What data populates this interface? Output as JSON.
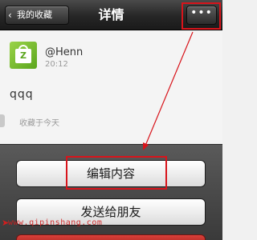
{
  "navbar": {
    "back_label": "我的收藏",
    "title": "详情",
    "more_label": "•••"
  },
  "note": {
    "username": "@Henn",
    "timestamp": "20:12",
    "text": "qqq",
    "saved_label": "收藏于今天"
  },
  "action_sheet": {
    "edit_label": "编辑内容",
    "send_label": "发送给朋友"
  },
  "watermark": "www.qipinshang.com",
  "icons": {
    "back": "chevron-left-icon",
    "more": "more-dots-icon",
    "avatar": "shopping-bag-icon"
  },
  "colors": {
    "annotation": "#d8141b",
    "navbar": "#262626",
    "danger": "#c0332d"
  }
}
